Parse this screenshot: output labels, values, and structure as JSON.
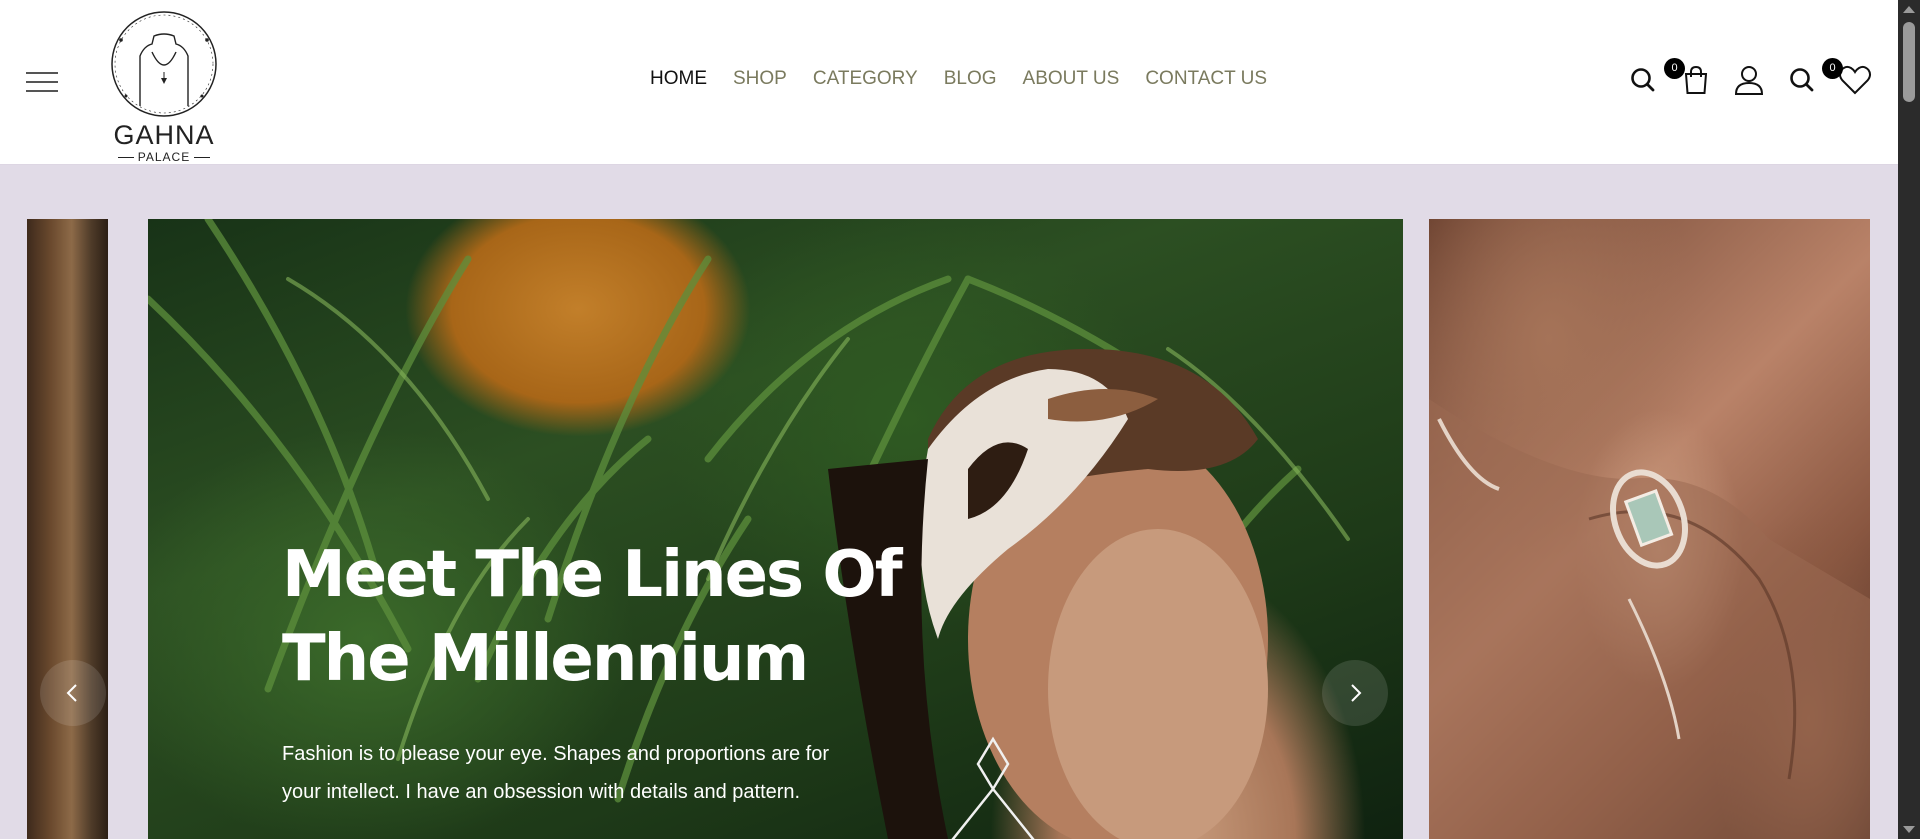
{
  "brand": {
    "name": "GAHNA",
    "sub": "PALACE"
  },
  "nav": {
    "items": [
      {
        "label": "HOME",
        "active": true
      },
      {
        "label": "SHOP",
        "active": false
      },
      {
        "label": "CATEGORY",
        "active": false
      },
      {
        "label": "BLOG",
        "active": false
      },
      {
        "label": "ABOUT US",
        "active": false
      },
      {
        "label": "CONTACT US",
        "active": false
      }
    ]
  },
  "header_icons": {
    "search": "search-icon",
    "cart": "shopping-bag-icon",
    "cart_count": "0",
    "account": "user-icon",
    "search_secondary": "search-icon",
    "wishlist": "heart-icon",
    "wishlist_count": "0"
  },
  "hero": {
    "title_line1": "Meet The Lines Of",
    "title_line2": "The Millennium",
    "text_line1": "Fashion is to please your eye. Shapes and proportions are for",
    "text_line2": "your intellect. I have an obsession with details and pattern."
  },
  "colors": {
    "background": "#e1dbe7",
    "header": "#ffffff",
    "nav_text": "#7a7a5e",
    "nav_active": "#111111",
    "badge": "#000000"
  }
}
